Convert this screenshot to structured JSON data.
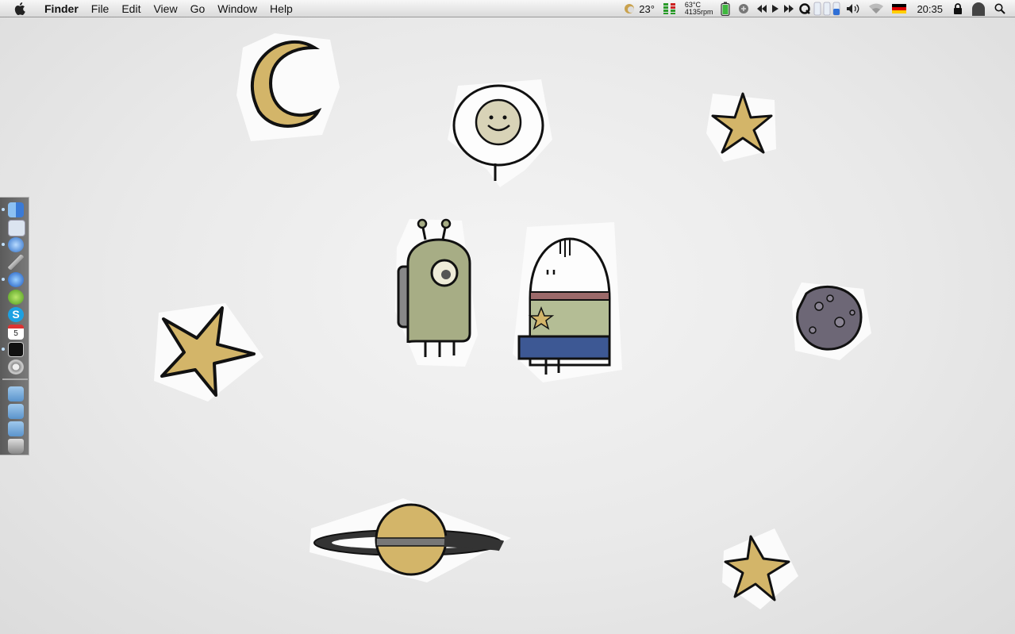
{
  "menubar": {
    "app_name": "Finder",
    "menus": [
      "File",
      "Edit",
      "View",
      "Go",
      "Window",
      "Help"
    ],
    "status": {
      "weather_temp": "23°",
      "cpu_temp": "63°C",
      "fan_speed": "4135rpm",
      "input_source": "German",
      "clock": "20:35"
    }
  },
  "dock": {
    "apps": [
      {
        "icon": "finder-icon",
        "running": true
      },
      {
        "icon": "textedit-icon",
        "running": false
      },
      {
        "icon": "safari-icon",
        "running": true
      },
      {
        "icon": "tools-icon",
        "running": false
      },
      {
        "icon": "itunes-icon",
        "running": true
      },
      {
        "icon": "adium-icon",
        "running": false
      },
      {
        "icon": "skype-icon",
        "running": false
      },
      {
        "icon": "ical-icon",
        "running": false,
        "label": "5"
      },
      {
        "icon": "terminal-icon",
        "running": true
      },
      {
        "icon": "system-preferences-icon",
        "running": false
      }
    ],
    "stacks": [
      {
        "icon": "applications-folder-icon"
      },
      {
        "icon": "documents-folder-icon"
      },
      {
        "icon": "downloads-folder-icon"
      },
      {
        "icon": "trash-icon"
      }
    ]
  },
  "wallpaper": {
    "colors": {
      "star": "#d3b569",
      "alien": "#a7ad85",
      "planet": "#6d6776",
      "ring": "#333",
      "band_blue": "#3d5894",
      "band_red": "#9c6a6a"
    },
    "stickers": [
      "moon",
      "smiley-balloon",
      "star",
      "alien",
      "astronaut",
      "moon-rock",
      "star",
      "saturn",
      "star"
    ]
  }
}
